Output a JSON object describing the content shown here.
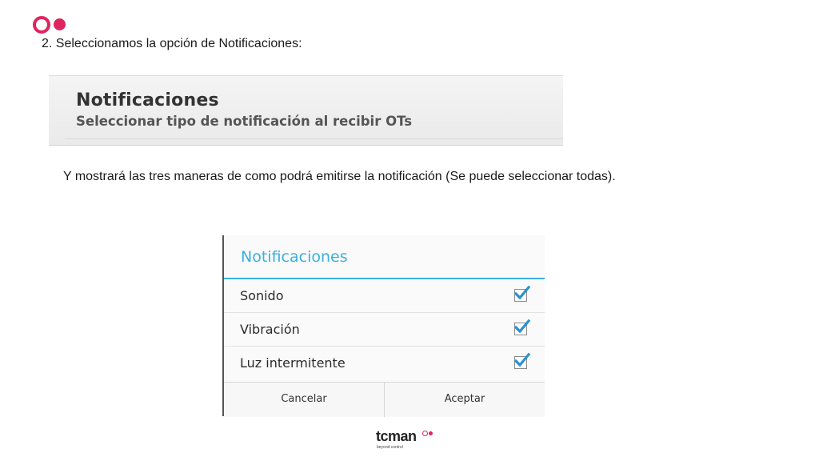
{
  "brand": {
    "logo_icon": "tcman-rings-logo",
    "accent_color": "#e0245e"
  },
  "step_heading": "2. Seleccionamos la opción de Notificaciones:",
  "preference_screenshot": {
    "title": "Notificaciones",
    "summary": "Seleccionar tipo de notificación al recibir OTs"
  },
  "explanation": "Y  mostrará las tres maneras de como podrá emitirse la notificación (Se puede seleccionar todas).",
  "dialog": {
    "title": "Notificaciones",
    "title_color": "#3ab0dc",
    "options": [
      {
        "label": "Sonido",
        "checked": true
      },
      {
        "label": "Vibración",
        "checked": true
      },
      {
        "label": "Luz intermitente",
        "checked": true
      }
    ],
    "cancel_label": "Cancelar",
    "accept_label": "Aceptar",
    "check_color": "#2a8fd0"
  },
  "footer": {
    "wordmark": "tcman",
    "tagline": "beyond control"
  }
}
